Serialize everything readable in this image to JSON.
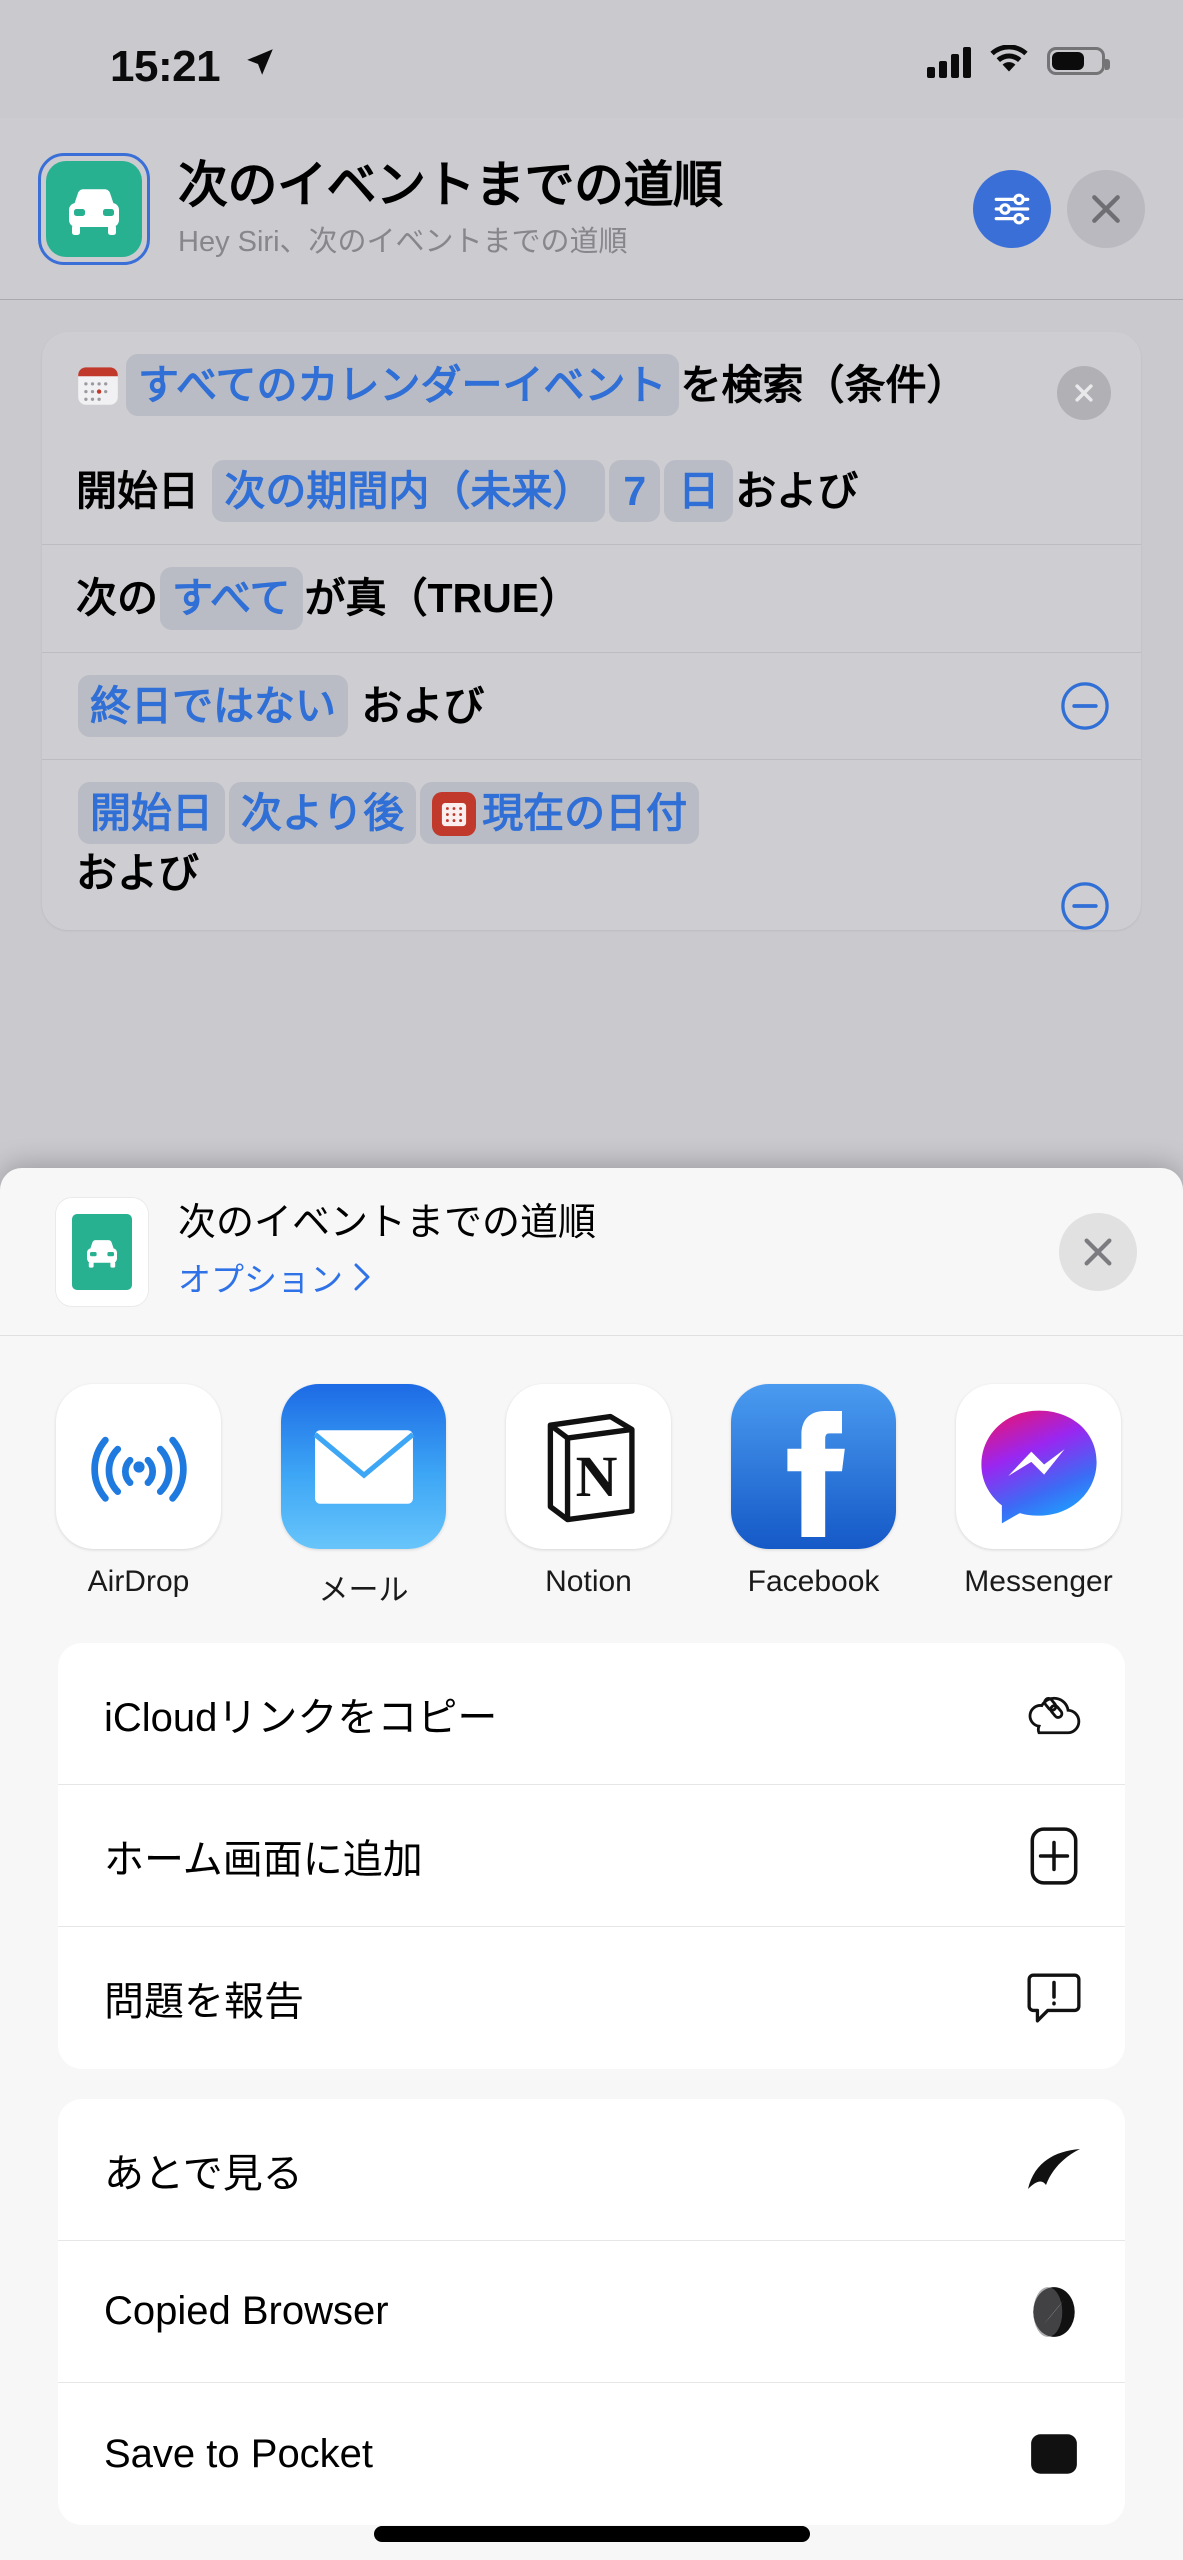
{
  "status_bar": {
    "time": "15:21",
    "location_icon": "location-arrow-icon",
    "cellular_icon": "cellular-bars-icon",
    "wifi_icon": "wifi-icon",
    "battery_icon": "battery-icon",
    "battery_level_pct": 62
  },
  "editor_header": {
    "shortcut_icon": "car-icon",
    "icon_color": "#28b191",
    "title": "次のイベントまでの道順",
    "subtitle": "Hey Siri、次のイベントまでの道順",
    "settings_button": "settings-sliders-icon",
    "close_button": "close-icon",
    "accent_color": "#3a6fd8"
  },
  "shortcut_action": {
    "blocks": [
      {
        "id": "find-calendar-events",
        "icon": "calendar-app-icon",
        "segments": [
          {
            "type": "token",
            "text": "すべてのカレンダーイベント"
          },
          {
            "type": "text",
            "text": "を検索（条件）"
          }
        ],
        "has_remove_x": true
      },
      {
        "id": "start-date-filter",
        "segments": [
          {
            "type": "text",
            "text": "開始日"
          },
          {
            "type": "token",
            "text": "次の期間内（未来）"
          },
          {
            "type": "token",
            "text": "7"
          },
          {
            "type": "token",
            "text": "日"
          },
          {
            "type": "text",
            "text": "および"
          }
        ]
      },
      {
        "id": "all-true-condition",
        "segments": [
          {
            "type": "text",
            "text": "次の"
          },
          {
            "type": "token",
            "text": "すべて"
          },
          {
            "type": "text",
            "text": "が真（TRUE）"
          }
        ]
      },
      {
        "id": "not-allday-condition",
        "segments": [
          {
            "type": "token",
            "text": "終日ではない"
          },
          {
            "type": "text",
            "text": "および"
          }
        ],
        "has_minus": true
      },
      {
        "id": "start-after-now-condition",
        "segments": [
          {
            "type": "token",
            "text": "開始日"
          },
          {
            "type": "token",
            "text": "次より後"
          },
          {
            "type": "token",
            "text": "現在の日付",
            "icon": "current-date-icon"
          },
          {
            "type": "text",
            "text": "および"
          }
        ],
        "has_minus": true
      }
    ]
  },
  "share_sheet": {
    "app_icon": "car-icon",
    "title": "次のイベントまでの道順",
    "options_label": "オプション",
    "options_chevron": "chevron-right-icon",
    "close_button": "close-icon",
    "apps": [
      {
        "label": "AirDrop",
        "icon": "airdrop-icon",
        "tile": "t-airdrop"
      },
      {
        "label": "メール",
        "icon": "mail-icon",
        "tile": "t-mail"
      },
      {
        "label": "Notion",
        "icon": "notion-icon",
        "tile": "t-notion"
      },
      {
        "label": "Facebook",
        "icon": "facebook-icon",
        "tile": "t-facebook"
      },
      {
        "label": "Messenger",
        "icon": "messenger-icon",
        "tile": "t-messenger"
      }
    ],
    "action_groups": [
      {
        "items": [
          {
            "label": "iCloudリンクをコピー",
            "icon": "icloud-link-icon"
          },
          {
            "label": "ホーム画面に追加",
            "icon": "add-to-homescreen-icon"
          },
          {
            "label": "問題を報告",
            "icon": "report-problem-icon"
          }
        ]
      },
      {
        "items": [
          {
            "label": "あとで見る",
            "icon": "read-later-icon"
          },
          {
            "label": "Copied Browser",
            "icon": "safari-compass-icon"
          },
          {
            "label": "Save to Pocket",
            "icon": "pocket-icon"
          }
        ]
      }
    ]
  }
}
